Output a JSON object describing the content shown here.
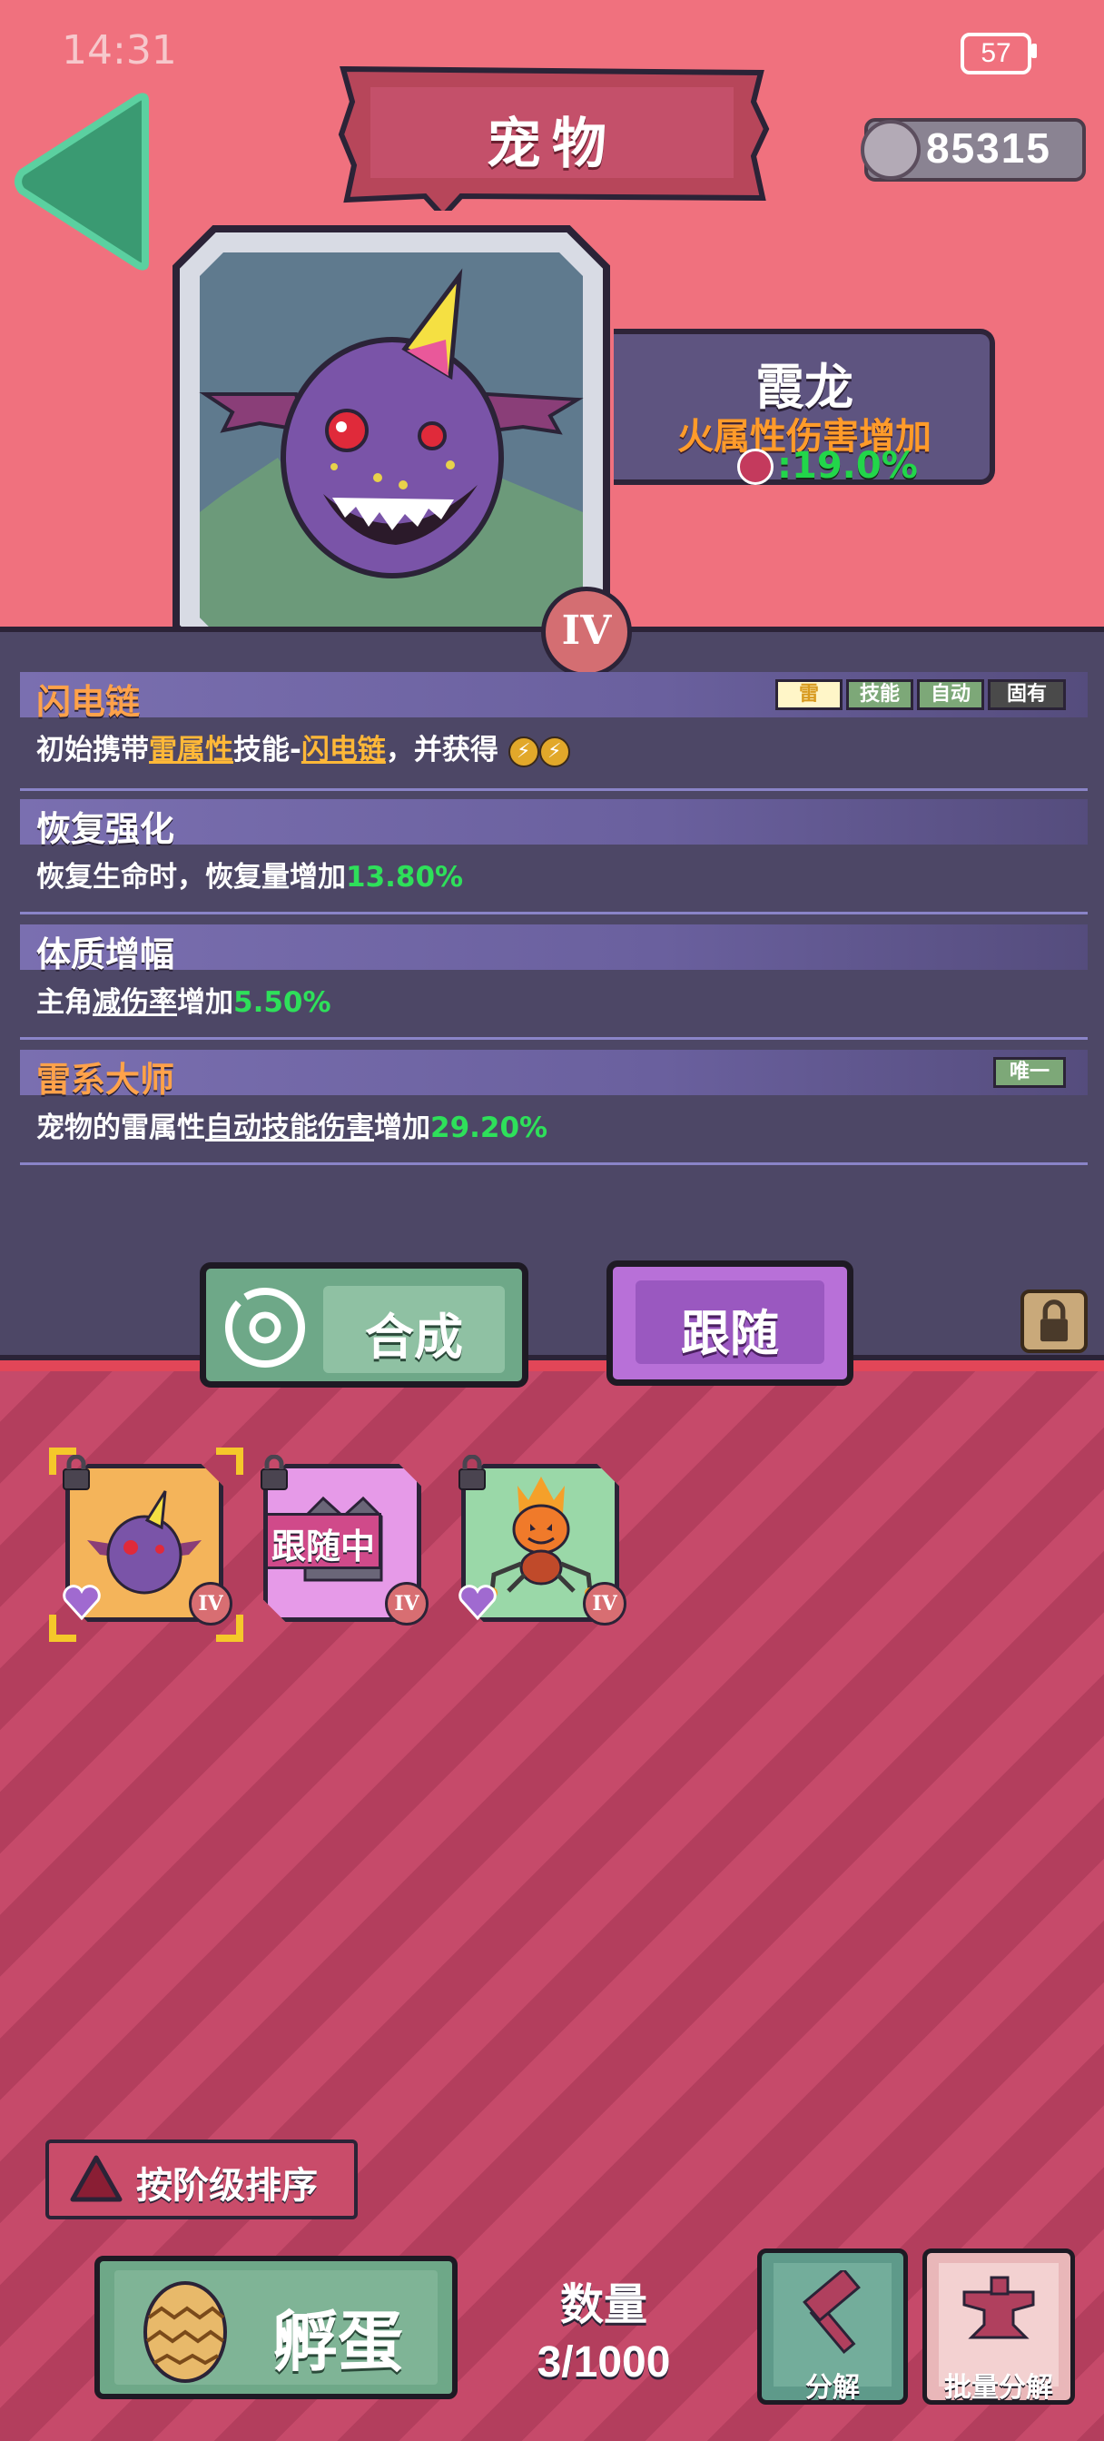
{
  "status_bar": {
    "time": "14:31",
    "battery": "57"
  },
  "header": {
    "title": "宠物",
    "currency_amount": "85315"
  },
  "pet": {
    "name": "霞龙",
    "attribute": "火属性伤害增加",
    "attribute_value": ":19.0%",
    "rank": "IV"
  },
  "skills": [
    {
      "title": "闪电链",
      "desc_parts": [
        "初始携带",
        "雷属性",
        "技能-",
        "闪电链",
        "，并获得"
      ],
      "tags": [
        "雷",
        "技能",
        "自动",
        "固有"
      ]
    },
    {
      "title": "恢复强化",
      "desc_prefix": "恢复生命时，恢复量增加",
      "desc_value": "13.80%"
    },
    {
      "title": "体质增幅",
      "desc_prefix": "主角",
      "desc_ul": "减伤率",
      "desc_mid": "增加",
      "desc_value": "5.50%"
    },
    {
      "title": "雷系大师",
      "desc_prefix": "宠物的雷属性",
      "desc_ul": "自动技能伤害",
      "desc_mid": "增加",
      "desc_value": "29.20%",
      "tag": "唯一"
    }
  ],
  "actions": {
    "synthesize": "合成",
    "follow": "跟随"
  },
  "inventory": {
    "slots": [
      {
        "rank": "IV"
      },
      {
        "rank": "IV",
        "banner": "跟随中"
      },
      {
        "rank": "IV"
      }
    ]
  },
  "footer": {
    "sort_label": "按阶级排序",
    "hatch_label": "孵蛋",
    "count_label": "数量",
    "count_value": "3/1000",
    "decompose_label": "分解",
    "batch_decompose_label": "批量分解"
  },
  "colors": {
    "background": "#f0717e",
    "panel": "#4d4766",
    "green_value": "#2ee05a",
    "orange_title": "#ffa24a",
    "follow_button": "#b870d8",
    "synth_button": "#6ea888"
  }
}
